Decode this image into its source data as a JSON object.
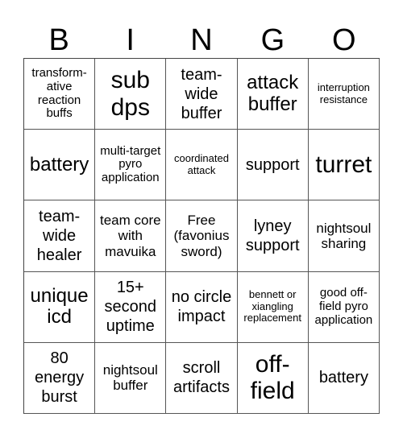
{
  "header": {
    "letters": [
      "B",
      "I",
      "N",
      "G",
      "O"
    ]
  },
  "cells": [
    {
      "text": "transform-ative reaction buffs",
      "size": "s-sm"
    },
    {
      "text": "sub dps",
      "size": "s-xxl"
    },
    {
      "text": "team-wide buffer",
      "size": "s-lg"
    },
    {
      "text": "attack buffer",
      "size": "s-xl"
    },
    {
      "text": "interruption resistance",
      "size": "s-xs"
    },
    {
      "text": "battery",
      "size": "s-xl"
    },
    {
      "text": "multi-target pyro application",
      "size": "s-sm"
    },
    {
      "text": "coordinated attack",
      "size": "s-xs"
    },
    {
      "text": "support",
      "size": "s-lg"
    },
    {
      "text": "turret",
      "size": "s-xxl"
    },
    {
      "text": "team-wide healer",
      "size": "s-lg"
    },
    {
      "text": "team core with mavuika",
      "size": "s-md"
    },
    {
      "text": "Free (favonius sword)",
      "size": "s-md"
    },
    {
      "text": "lyney support",
      "size": "s-lg"
    },
    {
      "text": "nightsoul sharing",
      "size": "s-md"
    },
    {
      "text": "unique icd",
      "size": "s-xl"
    },
    {
      "text": "15+ second uptime",
      "size": "s-lg"
    },
    {
      "text": "no circle impact",
      "size": "s-lg"
    },
    {
      "text": "bennett or xiangling replacement",
      "size": "s-xs"
    },
    {
      "text": "good off-field pyro application",
      "size": "s-sm"
    },
    {
      "text": "80 energy burst",
      "size": "s-lg"
    },
    {
      "text": "nightsoul buffer",
      "size": "s-md"
    },
    {
      "text": "scroll artifacts",
      "size": "s-lg"
    },
    {
      "text": "off-field",
      "size": "s-xxl"
    },
    {
      "text": "battery",
      "size": "s-lg"
    }
  ]
}
